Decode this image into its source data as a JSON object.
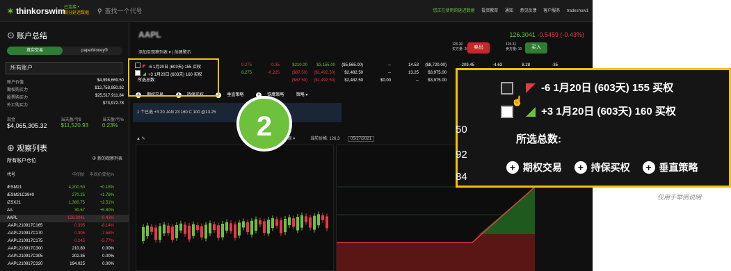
{
  "topbar": {
    "logo": "thinkorswim",
    "badge_line1": "已连接 •",
    "badge_line2": "部分延迟数据",
    "search_placeholder": "查找一个代号",
    "nav": [
      "您正在使用的延迟数据",
      "投资教育",
      "通知",
      "意见反馈",
      "客户服务",
      "tradeshow1"
    ]
  },
  "account": {
    "title": "账户总结",
    "tab_live": "真实交易",
    "tab_paper": "paperMoney®",
    "selector": "所有账户",
    "rows": [
      {
        "label": "账户价值",
        "value": "$4,998,669.50"
      },
      {
        "label": "期权购买力",
        "value": "$12,758,950.92"
      },
      {
        "label": "股票购买力",
        "value": "$25,517,911.84"
      },
      {
        "label": "外汇购买力",
        "value": "$73,972.78"
      }
    ],
    "cash_label": "现金",
    "cash_value": "$4,065,305.32",
    "pnl_label": "当天盈/亏$",
    "pnl_value": "$11,520.93",
    "pnl_pct_label": "当天盈/亏%",
    "pnl_pct_value": "0.23%"
  },
  "watchlist": {
    "title": "观察列表",
    "subtitle": "所有账户仓位",
    "new_label": "新的观察列表",
    "headers": [
      "代号",
      "中间价",
      "中间价变化%"
    ],
    "rows": [
      {
        "sym": "/ESM21",
        "mid": "4,200.50",
        "chg": "+0.18%",
        "c": "gr"
      },
      {
        "sym": "/ESM21C3940",
        "mid": "270.25",
        "chg": "+1.79%",
        "c": "gr"
      },
      {
        "sym": "/ZSX21",
        "mid": "1,380.75",
        "chg": "+2.51%",
        "c": "gr"
      },
      {
        "sym": "AA",
        "mid": "30.67",
        "chg": "+5.80%",
        "c": "gr"
      },
      {
        "sym": "AAPL",
        "mid": "126.3041",
        "chg": "-0.43%",
        "c": "rd"
      },
      {
        "sym": ".AAPL210917C165",
        "mid": "0.395",
        "chg": "-8.14%",
        "c": "rd"
      },
      {
        "sym": ".AAPL210917C170",
        "mid": "0.305",
        "chg": "-7.58%",
        "c": "rd"
      },
      {
        "sym": ".AAPL210917C175",
        "mid": "0.245",
        "chg": "-5.77%",
        "c": "rd"
      },
      {
        "sym": ".AAPL210917C300",
        "mid": "210.80",
        "chg": "0.00%",
        "c": "wh"
      },
      {
        "sym": ".AAPL210917C305",
        "mid": "202.35",
        "chg": "0.00%",
        "c": "wh"
      },
      {
        "sym": ".AAPL210917C320",
        "mid": "194.025",
        "chg": "0.00%",
        "c": "wh"
      }
    ]
  },
  "main": {
    "symbol": "AAPL",
    "price": "126.3041",
    "change": "-0.5459 (-0.43%)",
    "bid": "126.30",
    "bid_size": "买方量: 20",
    "ask": "126.31",
    "ask_size": "卖方量: 10",
    "sell_label": "卖出",
    "buy_label": "买入",
    "add_watchlist": "添加至观察列表 ▾ | 创建警示",
    "rows": [
      {
        "desc": "-6 1月20日 (603天) 155 买权",
        "v1": "9.275",
        "v2": "-0.35",
        "v3": "$210.00",
        "v4": "$3,155.00",
        "v5": "($5,565.00)",
        "v6": "--",
        "v7": "14.53",
        "v8": "($8,720.00)",
        "v9": "-209.45",
        "v10": "-4.63",
        "v11": "8.28",
        "v12": "-35"
      },
      {
        "desc": "+3 1月20日 (603天) 160 买权",
        "v1": "8.275",
        "v2": "-0.225",
        "v3": "($67.50)",
        "v4": "($1,492.50)",
        "v5": "$2,482.50",
        "v6": "--",
        "v7": "13.25",
        "v8": "$3,975.00",
        "v9": "",
        "v10": "",
        "v11": "",
        "v12": ""
      },
      {
        "desc": "所选总数:",
        "v1": "",
        "v2": "",
        "v3": "($67.50)",
        "v4": "($1,492.50)",
        "v5": "$2,482.50",
        "v6": "$0.00",
        "v7": "--",
        "v8": "$3,975.00",
        "v9": "",
        "v10": "",
        "v11": "",
        "v12": ""
      }
    ],
    "actions": [
      "期权交易",
      "持保买权",
      "垂直策略",
      "铁鹰策略",
      "策略 ▾"
    ],
    "selected_bar": "1 个已选  +3 20 JAN 23 160 C 100 @13.25",
    "chart_header": "当前价格: 126.3",
    "chart_date": "05/27/2021",
    "chart_period": "1周 ▾"
  },
  "callout_number": "2",
  "zoom": {
    "row1": "-6 1月20日 (603天) 155 买权",
    "row2": "+3 1月20日 (603天) 160 买权",
    "total": "所选总数:",
    "actions": [
      "期权交易",
      "持保买权",
      "垂直策略"
    ],
    "side_numbers": [
      "50",
      "92",
      "84"
    ]
  },
  "caption": "仅用于举例说明"
}
